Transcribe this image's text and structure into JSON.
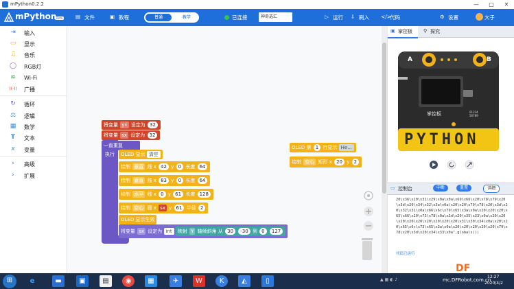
{
  "window": {
    "title": "mPython0.2.2",
    "controls": [
      "—",
      "□",
      "✕"
    ]
  },
  "toolbar": {
    "logo": "mPython",
    "logo_badge": "Beta",
    "file": "文件",
    "tutorial": "教程",
    "mode_active": "普通",
    "mode_inactive": "教学",
    "status": "已连接",
    "device_name": "神奇选汇",
    "run": "运行",
    "flash": "刷入",
    "code": "代码",
    "settings": "设置",
    "user": "大于",
    "colors": {
      "bar": "#1e6fd9",
      "connected": "#39c34a"
    }
  },
  "sidebar": {
    "items": [
      {
        "label": "输入",
        "icon": "input-icon",
        "glyph": "⇥",
        "color": "#2f7be8"
      },
      {
        "label": "显示",
        "icon": "display-icon",
        "glyph": "▭",
        "color": "#f2b21b"
      },
      {
        "label": "音乐",
        "icon": "music-icon",
        "glyph": "♫",
        "color": "#f2b21b"
      },
      {
        "label": "RGB灯",
        "icon": "bulb-icon",
        "glyph": "◯",
        "color": "#8a5ad9"
      },
      {
        "label": "Wi-Fi",
        "icon": "wifi-icon",
        "glyph": "≋",
        "color": "#2f9e44"
      },
      {
        "label": "广播",
        "icon": "broadcast-icon",
        "glyph": "((·))",
        "color": "#d0442a"
      },
      {
        "label": "循环",
        "icon": "loop-icon",
        "glyph": "↻",
        "color": "#6b58c4"
      },
      {
        "label": "逻辑",
        "icon": "logic-icon",
        "glyph": "⚖",
        "color": "#3f8fd8"
      },
      {
        "label": "数学",
        "icon": "math-icon",
        "glyph": "▦",
        "color": "#3f8fd8"
      },
      {
        "label": "文本",
        "icon": "text-icon",
        "glyph": "T",
        "color": "#3f8fd8"
      },
      {
        "label": "变量",
        "icon": "variable-icon",
        "glyph": "x",
        "color": "#3f8fd8"
      },
      {
        "label": "高级",
        "icon": "chevron-right-icon",
        "glyph": "›",
        "color": "#2f7be8"
      },
      {
        "label": "扩展",
        "icon": "chevron-right-icon",
        "glyph": "›",
        "color": "#2f7be8"
      }
    ]
  },
  "blocks": {
    "set_var_1": {
      "prefix": "将变量",
      "var": "yx",
      "mid": "设定为",
      "value": "32"
    },
    "set_var_2": {
      "prefix": "将变量",
      "var": "sx",
      "mid": "设定为",
      "value": "32"
    },
    "forever": "一直重复",
    "do": "执行",
    "oled_show": {
      "label": "OLED 显示",
      "value": "清空"
    },
    "draw_1": {
      "a": "绘制",
      "b": "垂直",
      "c": "线 x",
      "x": "42",
      "d": "y",
      "y": "0",
      "e": "长度",
      "len": "64"
    },
    "draw_2": {
      "a": "绘制",
      "b": "垂直",
      "c": "线 x",
      "x": "83",
      "d": "y",
      "y": "0",
      "e": "长度",
      "len": "64"
    },
    "draw_3": {
      "a": "绘制",
      "b": "水平",
      "c": "线 x",
      "x": "0",
      "d": "y",
      "y": "61",
      "e": "长度",
      "len": "128"
    },
    "draw_4": {
      "a": "绘制",
      "b": "空心",
      "c": "圆 x",
      "x": "sx",
      "d": "y",
      "y": "61",
      "e": "半径",
      "len": "2"
    },
    "oled_apply": "OLED 显示生效",
    "set_var_3": {
      "prefix": "将变量",
      "var": "sx",
      "mid": "设定为",
      "type": "int",
      "map": "映射",
      "axis": "Y",
      "axis_suffix": "轴倾斜角",
      "from": "从",
      "v1": "30",
      "v2": "-30",
      "to": "到",
      "v3": "0",
      "v4": "127"
    },
    "oled_line": {
      "label": "OLED 第",
      "row": "1",
      "suffix": "行显示",
      "text": "He..."
    },
    "draw_rect": {
      "a": "绘制",
      "b": "空心",
      "c": "矩形 x",
      "x": "20",
      "d": "y",
      "y": "2"
    }
  },
  "right_panel": {
    "tab_board": "掌控板",
    "tab_explore": "探究",
    "board_text": "PYTHON",
    "board_labels": {
      "a": "A",
      "b": "B",
      "name": "掌控板",
      "serial": "01234 56789"
    },
    "console_title": "控制台",
    "console_btn_1": "中断",
    "console_btn_2": "重置",
    "console_btn_3": "详细",
    "console_text": "20\\x36\\x20\\x31\\x29\\x0a\\x0a\\x69\\x66\\x20\\x78\\x79\\x20\\x3d\\x20\\x34\\x32\\x3a\\x0a\\x20\\x20\\x79\\x78\\x20\\x3d\\x20\\x32\\x31\\x0a\\x66\\x6c\\x79\\x65\\x3a\\x0a\\x20\\x20\\x20\\x65\\x66\\x20\\x73\\x78\\x0a\\x3d\\x20\\x35\\x33\\x0a\\x20\\x20\\x20\\x20\\x20\\x20\\x20\\x20\\x20\\x31\\x30\\x34\\x0a\\x20\\x20\\x65\\x6c\\x73\\x65\\x3a\\x0a\\x20\\x20\\x20\\x20\\x20\\x79\\x78\\x20\\x3d\\x20\\x34\\x33\\x0a\",globals())",
    "console_link": "代码已运行"
  },
  "taskbar": {
    "time": "12:27",
    "date": "2020/4/2",
    "tray_text": "mc.DFRobot.com.cn",
    "watermark": "DF",
    "icons": [
      "start-icon",
      "ie-icon",
      "folder-icon",
      "media-icon",
      "chrome-icon",
      "app-icon",
      "app-icon",
      "bird-icon",
      "wps-icon",
      "k-icon",
      "mpython-icon",
      "phone-icon"
    ]
  }
}
